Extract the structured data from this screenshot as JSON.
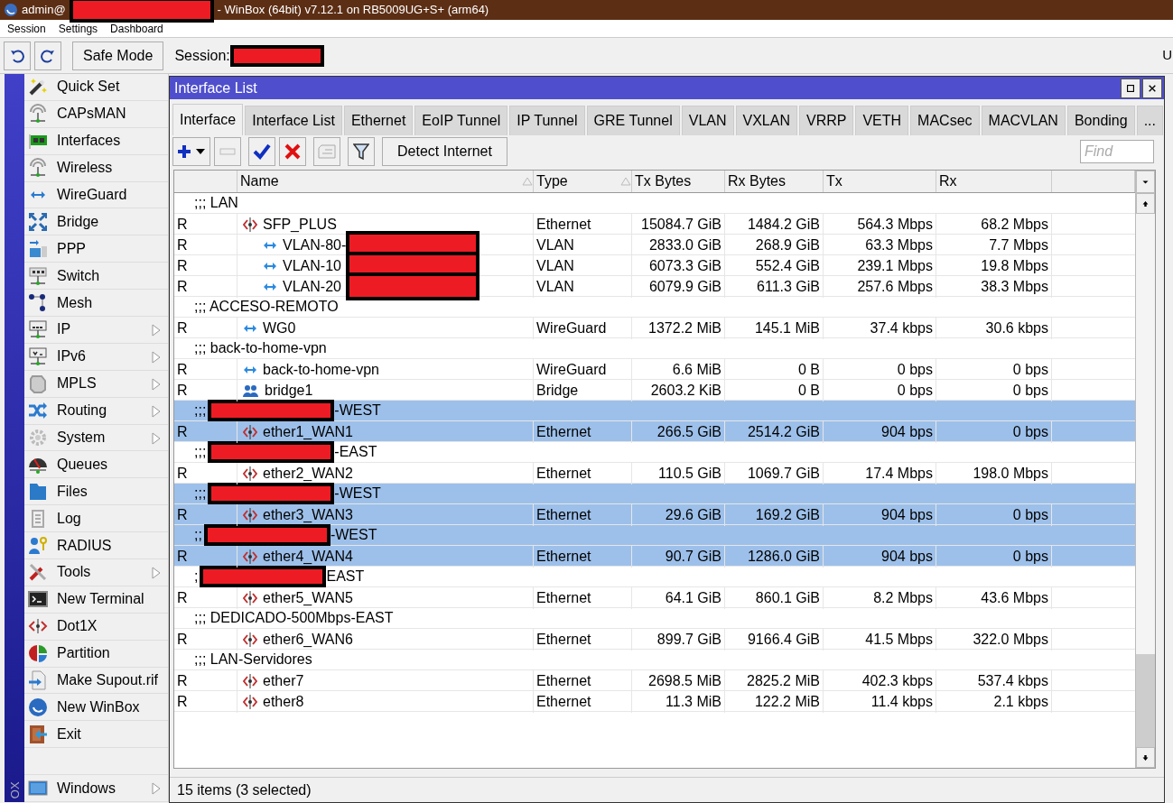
{
  "title_bar": {
    "user": "admin@",
    "redacted": true,
    "text": "- WinBox (64bit) v7.12.1 on RB5009UG+S+ (arm64)"
  },
  "menu": [
    "Session",
    "Settings",
    "Dashboard"
  ],
  "toolbar": {
    "safe_mode": "Safe Mode",
    "session_label": "Session:",
    "session_redacted": true,
    "edge_text": "U"
  },
  "sidebar": {
    "brand": "OX",
    "items": [
      {
        "label": "Quick Set",
        "submenu": false
      },
      {
        "label": "CAPsMAN",
        "submenu": false
      },
      {
        "label": "Interfaces",
        "submenu": false
      },
      {
        "label": "Wireless",
        "submenu": false
      },
      {
        "label": "WireGuard",
        "submenu": false
      },
      {
        "label": "Bridge",
        "submenu": false
      },
      {
        "label": "PPP",
        "submenu": false
      },
      {
        "label": "Switch",
        "submenu": false
      },
      {
        "label": "Mesh",
        "submenu": false
      },
      {
        "label": "IP",
        "submenu": true
      },
      {
        "label": "IPv6",
        "submenu": true
      },
      {
        "label": "MPLS",
        "submenu": true
      },
      {
        "label": "Routing",
        "submenu": true
      },
      {
        "label": "System",
        "submenu": true
      },
      {
        "label": "Queues",
        "submenu": false
      },
      {
        "label": "Files",
        "submenu": false
      },
      {
        "label": "Log",
        "submenu": false
      },
      {
        "label": "RADIUS",
        "submenu": false
      },
      {
        "label": "Tools",
        "submenu": true
      },
      {
        "label": "New Terminal",
        "submenu": false
      },
      {
        "label": "Dot1X",
        "submenu": false
      },
      {
        "label": "Partition",
        "submenu": false
      },
      {
        "label": "Make Supout.rif",
        "submenu": false
      },
      {
        "label": "New WinBox",
        "submenu": false
      },
      {
        "label": "Exit",
        "submenu": false
      },
      {
        "label": "Windows",
        "submenu": true,
        "kind": "bottom"
      }
    ]
  },
  "window": {
    "title": "Interface List",
    "tabs": [
      {
        "label": "Interface",
        "selected": true
      },
      {
        "label": "Interface List",
        "selected": false
      },
      {
        "label": "Ethernet",
        "selected": false
      },
      {
        "label": "EoIP Tunnel",
        "selected": false
      },
      {
        "label": "IP Tunnel",
        "selected": false
      },
      {
        "label": "GRE Tunnel",
        "selected": false
      },
      {
        "label": "VLAN",
        "selected": false
      },
      {
        "label": "VXLAN",
        "selected": false
      },
      {
        "label": "VRRP",
        "selected": false
      },
      {
        "label": "VETH",
        "selected": false
      },
      {
        "label": "MACsec",
        "selected": false
      },
      {
        "label": "MACVLAN",
        "selected": false
      },
      {
        "label": "Bonding",
        "selected": false
      },
      {
        "label": "...",
        "selected": false
      }
    ],
    "detect_button": "Detect Internet",
    "find": {
      "placeholder": "Find"
    },
    "columns": [
      {
        "label": "Name",
        "sortable": true
      },
      {
        "label": "Type",
        "sortable": true
      },
      {
        "label": "Tx Bytes",
        "sortable": false
      },
      {
        "label": "Rx Bytes",
        "sortable": false
      },
      {
        "label": "Tx",
        "sortable": false
      },
      {
        "label": "Rx",
        "sortable": false
      }
    ],
    "rows": [
      {
        "kind": "comment",
        "prefix": ";;;",
        "text": "LAN",
        "redacted": false,
        "selected": false
      },
      {
        "kind": "ethernet",
        "flag": "R",
        "name": "SFP_PLUS",
        "type": "Ethernet",
        "tx_bytes": "15084.7 GiB",
        "rx_bytes": "1484.2 GiB",
        "tx": "564.3 Mbps",
        "rx": "68.2 Mbps",
        "selected": false,
        "children": [
          {
            "kind": "tunnel",
            "flag": "R",
            "name": "VLAN-80-",
            "redacted": true,
            "type": "VLAN",
            "tx_bytes": "2833.0 GiB",
            "rx_bytes": "268.9 GiB",
            "tx": "63.3 Mbps",
            "rx": "7.7 Mbps",
            "selected": false
          },
          {
            "kind": "tunnel",
            "flag": "R",
            "name": "VLAN-10",
            "redacted": true,
            "type": "VLAN",
            "tx_bytes": "6073.3 GiB",
            "rx_bytes": "552.4 GiB",
            "tx": "239.1 Mbps",
            "rx": "19.8 Mbps",
            "selected": false
          },
          {
            "kind": "tunnel",
            "flag": "R",
            "name": "VLAN-20",
            "redacted": true,
            "type": "VLAN",
            "tx_bytes": "6079.9 GiB",
            "rx_bytes": "611.3 GiB",
            "tx": "257.6 Mbps",
            "rx": "38.3 Mbps",
            "selected": false
          }
        ]
      },
      {
        "kind": "comment",
        "prefix": ";;;",
        "text": "ACCESO-REMOTO",
        "redacted": false,
        "selected": false
      },
      {
        "kind": "tunnel",
        "flag": "R",
        "name": "WG0",
        "type": "WireGuard",
        "tx_bytes": "1372.2 MiB",
        "rx_bytes": "145.1 MiB",
        "tx": "37.4 kbps",
        "rx": "30.6 kbps",
        "selected": false
      },
      {
        "kind": "comment",
        "prefix": ";;;",
        "text": "back-to-home-vpn",
        "redacted": false,
        "selected": false
      },
      {
        "kind": "tunnel",
        "flag": "R",
        "name": "back-to-home-vpn",
        "type": "WireGuard",
        "tx_bytes": "6.6 MiB",
        "rx_bytes": "0 B",
        "tx": "0 bps",
        "rx": "0 bps",
        "selected": false
      },
      {
        "kind": "bridge",
        "flag": "R",
        "name": "bridge1",
        "type": "Bridge",
        "tx_bytes": "2603.2 KiB",
        "rx_bytes": "0 B",
        "tx": "0 bps",
        "rx": "0 bps",
        "selected": false
      },
      {
        "kind": "comment",
        "prefix": ";;;",
        "text": "-WEST",
        "redacted": true,
        "selected": true
      },
      {
        "kind": "ethernet",
        "flag": "R",
        "name": "ether1_WAN1",
        "type": "Ethernet",
        "tx_bytes": "266.5 GiB",
        "rx_bytes": "2514.2 GiB",
        "tx": "904 bps",
        "rx": "0 bps",
        "selected": true
      },
      {
        "kind": "comment",
        "prefix": ";;;",
        "text": "-EAST",
        "redacted": true,
        "selected": false
      },
      {
        "kind": "ethernet",
        "flag": "R",
        "name": "ether2_WAN2",
        "type": "Ethernet",
        "tx_bytes": "110.5 GiB",
        "rx_bytes": "1069.7 GiB",
        "tx": "17.4 Mbps",
        "rx": "198.0 Mbps",
        "selected": false
      },
      {
        "kind": "comment",
        "prefix": ";;;",
        "text": "-WEST",
        "redacted": true,
        "selected": true
      },
      {
        "kind": "ethernet",
        "flag": "R",
        "name": "ether3_WAN3",
        "type": "Ethernet",
        "tx_bytes": "29.6 GiB",
        "rx_bytes": "169.2 GiB",
        "tx": "904 bps",
        "rx": "0 bps",
        "selected": true
      },
      {
        "kind": "comment",
        "prefix": ";;",
        "text": "-WEST",
        "redacted": true,
        "selected": true
      },
      {
        "kind": "ethernet",
        "flag": "R",
        "name": "ether4_WAN4",
        "type": "Ethernet",
        "tx_bytes": "90.7 GiB",
        "rx_bytes": "1286.0 GiB",
        "tx": "904 bps",
        "rx": "0 bps",
        "selected": true
      },
      {
        "kind": "comment",
        "prefix": ";",
        "text": "EAST",
        "redacted": true,
        "selected": false
      },
      {
        "kind": "ethernet",
        "flag": "R",
        "name": "ether5_WAN5",
        "type": "Ethernet",
        "tx_bytes": "64.1 GiB",
        "rx_bytes": "860.1 GiB",
        "tx": "8.2 Mbps",
        "rx": "43.6 Mbps",
        "selected": false
      },
      {
        "kind": "comment",
        "prefix": ";;;",
        "text": "DEDICADO-500Mbps-EAST",
        "redacted": false,
        "selected": false
      },
      {
        "kind": "ethernet",
        "flag": "R",
        "name": "ether6_WAN6",
        "type": "Ethernet",
        "tx_bytes": "899.7 GiB",
        "rx_bytes": "9166.4 GiB",
        "tx": "41.5 Mbps",
        "rx": "322.0 Mbps",
        "selected": false
      },
      {
        "kind": "comment",
        "prefix": ";;;",
        "text": "LAN-Servidores",
        "redacted": false,
        "selected": false
      },
      {
        "kind": "ethernet",
        "flag": "R",
        "name": "ether7",
        "type": "Ethernet",
        "tx_bytes": "2698.5 MiB",
        "rx_bytes": "2825.2 MiB",
        "tx": "402.3 kbps",
        "rx": "537.4 kbps",
        "selected": false
      },
      {
        "kind": "ethernet",
        "flag": "R",
        "name": "ether8",
        "type": "Ethernet",
        "tx_bytes": "11.3 MiB",
        "rx_bytes": "122.2 MiB",
        "tx": "11.4 kbps",
        "rx": "2.1 kbps",
        "selected": false
      }
    ],
    "status": "15 items (3 selected)"
  }
}
